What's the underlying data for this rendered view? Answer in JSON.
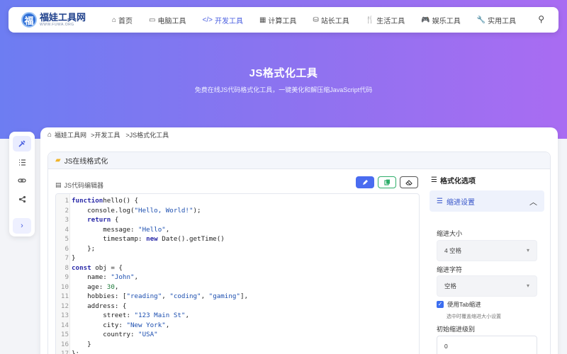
{
  "site": {
    "logo_char": "福",
    "name": "福娃工具网",
    "domain": "WWW.FUWA.ORG"
  },
  "nav": {
    "items": [
      {
        "label": "首页",
        "icon": "⌂"
      },
      {
        "label": "电脑工具",
        "icon": "▭"
      },
      {
        "label": "开发工具",
        "icon": "</>"
      },
      {
        "label": "计算工具",
        "icon": "▦"
      },
      {
        "label": "站长工具",
        "icon": "⛁"
      },
      {
        "label": "生活工具",
        "icon": "🍴"
      },
      {
        "label": "娱乐工具",
        "icon": "🎮"
      },
      {
        "label": "实用工具",
        "icon": "🔧"
      }
    ],
    "active_index": 2,
    "search_icon": "⚲"
  },
  "hero": {
    "title": "JS格式化工具",
    "subtitle": "免费在线JS代码格式化工具，一键美化和解压缩JavaScript代码"
  },
  "sidebar": {
    "icons": [
      "tools-icon",
      "list-icon",
      "link-icon",
      "share-icon"
    ],
    "toggle": "›"
  },
  "breadcrumb": {
    "items": [
      "福娃工具网",
      ">开发工具",
      ">JS格式化工具"
    ]
  },
  "tool": {
    "title": "JS在线格式化",
    "editor_label": "JS代码编辑器"
  },
  "code_lines": [
    [
      [
        "kw",
        "function"
      ],
      [
        "",
        "hello() {"
      ]
    ],
    [
      [
        "",
        "    console.log("
      ],
      [
        "str",
        "\"Hello, World!\""
      ],
      [
        "",
        ");"
      ]
    ],
    [
      [
        "",
        "    "
      ],
      [
        "kw",
        "return"
      ],
      [
        "",
        " {"
      ]
    ],
    [
      [
        "",
        "        message: "
      ],
      [
        "str",
        "\"Hello\""
      ],
      [
        "",
        ","
      ]
    ],
    [
      [
        "",
        "        timestamp: "
      ],
      [
        "kw",
        "new"
      ],
      [
        "",
        " Date().getTime()"
      ]
    ],
    [
      [
        "",
        "    };"
      ]
    ],
    [
      [
        "",
        "}"
      ]
    ],
    [
      [
        "kw",
        "const"
      ],
      [
        "",
        " obj = {"
      ]
    ],
    [
      [
        "",
        "    name: "
      ],
      [
        "str",
        "\"John\""
      ],
      [
        "",
        ","
      ]
    ],
    [
      [
        "",
        "    age: "
      ],
      [
        "num",
        "30"
      ],
      [
        "",
        ","
      ]
    ],
    [
      [
        "",
        "    hobbies: ["
      ],
      [
        "str",
        "\"reading\""
      ],
      [
        "",
        ", "
      ],
      [
        "str",
        "\"coding\""
      ],
      [
        "",
        ", "
      ],
      [
        "str",
        "\"gaming\""
      ],
      [
        "",
        "],"
      ]
    ],
    [
      [
        "",
        "    address: {"
      ]
    ],
    [
      [
        "",
        "        street: "
      ],
      [
        "str",
        "\"123 Main St\""
      ],
      [
        "",
        ","
      ]
    ],
    [
      [
        "",
        "        city: "
      ],
      [
        "str",
        "\"New York\""
      ],
      [
        "",
        ","
      ]
    ],
    [
      [
        "",
        "        country: "
      ],
      [
        "str",
        "\"USA\""
      ]
    ],
    [
      [
        "",
        "    }"
      ]
    ],
    [
      [
        "",
        "};"
      ]
    ]
  ],
  "options": {
    "title": "格式化选项",
    "section": "缩进设置",
    "indent_size_label": "缩进大小",
    "indent_size_value": "4 空格",
    "indent_char_label": "缩进字符",
    "indent_char_value": "空格",
    "use_tab_label": "使用Tab缩进",
    "use_tab_checked": true,
    "use_tab_hint": "选中时覆盖缩进大小设置",
    "initial_level_label": "初始缩进级别",
    "initial_level_value": "0"
  },
  "colors": {
    "accent": "#4a5fe0",
    "hero_start": "#6d7df2",
    "hero_end": "#a96cf2",
    "copy_green": "#2fae6a"
  }
}
